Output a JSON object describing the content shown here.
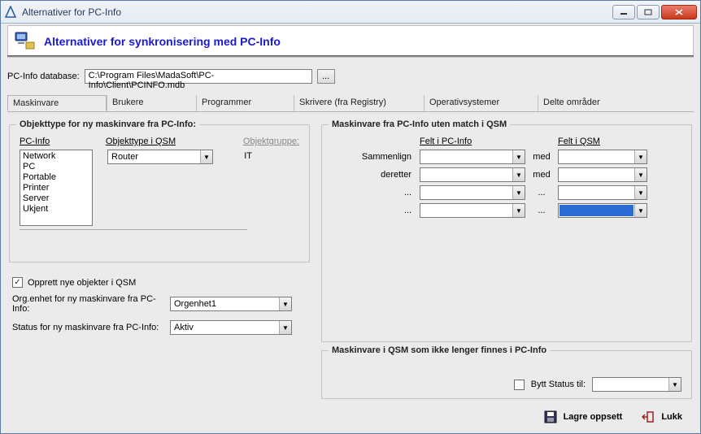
{
  "title": "Alternativer for PC-Info",
  "header_title": "Alternativer for synkronisering med PC-Info",
  "db": {
    "label": "PC-Info database:",
    "path": "C:\\Program Files\\MadaSoft\\PC-Info\\Client\\PCINFO.mdb"
  },
  "tabs": [
    "Maskinvare",
    "Brukere",
    "Programmer",
    "Skrivere (fra Registry)",
    "Operativsystemer",
    "Delte områder"
  ],
  "g1": {
    "title": "Objekttype for ny maskinvare fra PC-Info:",
    "col1": "PC-Info",
    "col2": "Objekttype i QSM",
    "col3": "Objektgruppe:",
    "list": [
      "Network",
      "PC",
      "Portable",
      "Printer",
      "Server",
      "Ukjent"
    ],
    "qsm_type": "Router",
    "group": "IT"
  },
  "opts": {
    "create_label": "Opprett nye objekter i QSM",
    "org_label": "Org.enhet for ny maskinvare fra PC-Info:",
    "org_value": "Orgenhet1",
    "status_label": "Status for ny maskinvare fra PC-Info:",
    "status_value": "Aktiv"
  },
  "g2": {
    "title": "Maskinvare fra PC-Info uten match i QSM",
    "fh1": "Felt i PC-Info",
    "fh2": "Felt i QSM",
    "rows": [
      {
        "lab": "Sammenlign",
        "mid": "med"
      },
      {
        "lab": "deretter",
        "mid": "med"
      },
      {
        "lab": "...",
        "mid": "..."
      },
      {
        "lab": "...",
        "mid": "..."
      }
    ]
  },
  "g3": {
    "title": "Maskinvare i QSM som ikke lenger finnes i PC-Info",
    "cb": "Bytt Status til:"
  },
  "footer": {
    "save": "Lagre oppsett",
    "close": "Lukk"
  }
}
